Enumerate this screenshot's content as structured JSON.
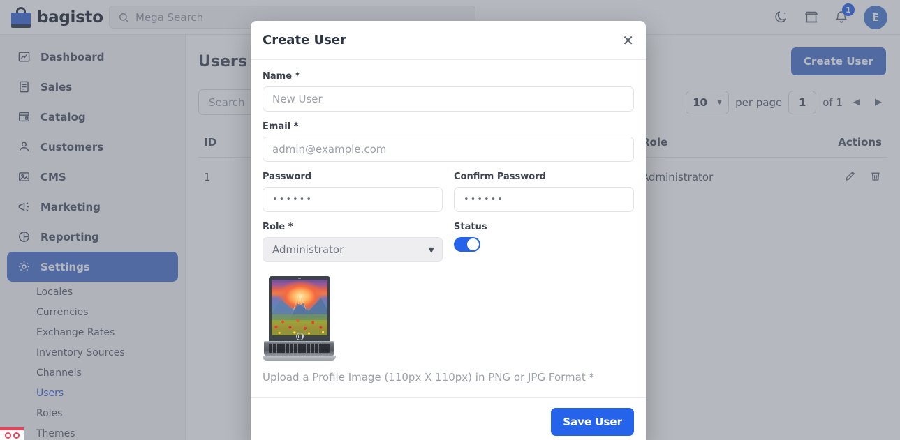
{
  "topbar": {
    "brand_name": "bagisto",
    "brand_icon": "shopping-bag-icon",
    "search_placeholder": "Mega Search",
    "search_icon": "search-icon",
    "theme_icon": "moon-icon",
    "store_icon": "storefront-icon",
    "notification_icon": "bell-icon",
    "notification_count": "1",
    "avatar_initial": "E"
  },
  "sidebar": {
    "items": [
      {
        "label": "Dashboard",
        "icon": "dashboard-icon",
        "active": false
      },
      {
        "label": "Sales",
        "icon": "sales-icon",
        "active": false
      },
      {
        "label": "Catalog",
        "icon": "catalog-icon",
        "active": false
      },
      {
        "label": "Customers",
        "icon": "customers-icon",
        "active": false
      },
      {
        "label": "CMS",
        "icon": "cms-icon",
        "active": false
      },
      {
        "label": "Marketing",
        "icon": "marketing-icon",
        "active": false
      },
      {
        "label": "Reporting",
        "icon": "reporting-icon",
        "active": false
      },
      {
        "label": "Settings",
        "icon": "gear-icon",
        "active": true
      }
    ],
    "sub_items": [
      {
        "label": "Locales",
        "active": false
      },
      {
        "label": "Currencies",
        "active": false
      },
      {
        "label": "Exchange Rates",
        "active": false
      },
      {
        "label": "Inventory Sources",
        "active": false
      },
      {
        "label": "Channels",
        "active": false
      },
      {
        "label": "Users",
        "active": true
      },
      {
        "label": "Roles",
        "active": false
      },
      {
        "label": "Themes",
        "active": false
      }
    ]
  },
  "content": {
    "page_title": "Users",
    "create_button": "Create User",
    "search_placeholder": "Search",
    "pagination": {
      "per_page_value": "10",
      "per_page_label": "per page",
      "current_page": "1",
      "of_label": "of 1",
      "prev_icon": "caret-left-icon",
      "next_icon": "caret-right-icon"
    },
    "table": {
      "columns": [
        "ID",
        "Role",
        "Actions"
      ],
      "rows": [
        {
          "id": "1",
          "role": "Administrator",
          "edit_icon": "pencil-icon",
          "delete_icon": "trash-icon"
        }
      ]
    }
  },
  "modal": {
    "title": "Create User",
    "close_icon": "close-icon",
    "fields": {
      "name_label": "Name *",
      "name_value": "New User",
      "email_label": "Email *",
      "email_value": "admin@example.com",
      "password_label": "Password",
      "password_value": "••••••",
      "confirm_password_label": "Confirm Password",
      "confirm_password_value": "••••••",
      "role_label": "Role *",
      "role_value": "Administrator",
      "role_options": [
        "Administrator"
      ],
      "status_label": "Status",
      "status_on": true
    },
    "image_alt": "laptop-profile-image",
    "upload_helper": "Upload a Profile Image (110px X 110px) in PNG or JPG Format *",
    "save_button": "Save User"
  },
  "colors": {
    "brand_blue": "#3b64d6",
    "accent_blue": "#2563eb",
    "sidebar_active": "#4a73cd",
    "alert_red": "#ef3e56"
  }
}
